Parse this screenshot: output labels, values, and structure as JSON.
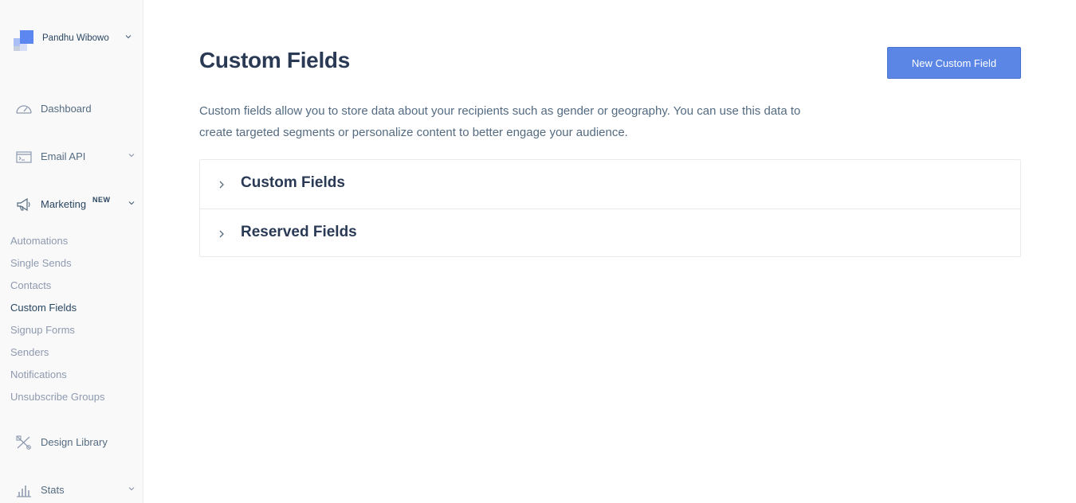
{
  "account": {
    "name": "Pandhu Wibowo"
  },
  "nav": {
    "dashboard": {
      "label": "Dashboard",
      "icon": "dashboard-gauge-icon"
    },
    "email_api": {
      "label": "Email API",
      "icon": "terminal-window-icon"
    },
    "marketing": {
      "label": "Marketing",
      "badge": "NEW",
      "icon": "megaphone-icon"
    },
    "marketing_items": [
      {
        "label": "Automations",
        "active": false
      },
      {
        "label": "Single Sends",
        "active": false
      },
      {
        "label": "Contacts",
        "active": false
      },
      {
        "label": "Custom Fields",
        "active": true
      },
      {
        "label": "Signup Forms",
        "active": false
      },
      {
        "label": "Senders",
        "active": false
      },
      {
        "label": "Notifications",
        "active": false
      },
      {
        "label": "Unsubscribe Groups",
        "active": false
      }
    ],
    "design_library": {
      "label": "Design Library",
      "icon": "design-tools-icon"
    },
    "stats": {
      "label": "Stats",
      "icon": "stats-chart-icon"
    }
  },
  "main": {
    "title": "Custom Fields",
    "new_button_label": "New Custom Field",
    "description": "Custom fields allow you to store data about your recipients such as gender or geography. You can use this data to create targeted segments or personalize content to better engage your audience.",
    "sections": [
      {
        "title": "Custom Fields"
      },
      {
        "title": "Reserved Fields"
      }
    ]
  },
  "colors": {
    "accent": "#5b86e5",
    "text_primary": "#2a3a55",
    "text_muted": "#8e9ab0",
    "sidebar_bg": "#f9f9f9"
  }
}
